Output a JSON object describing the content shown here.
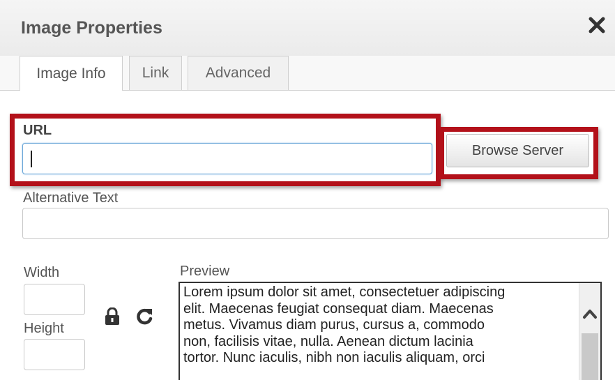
{
  "dialog": {
    "title": "Image Properties",
    "close_icon": "close-icon"
  },
  "tabs": [
    {
      "label": "Image Info",
      "active": true
    },
    {
      "label": "Link",
      "active": false
    },
    {
      "label": "Advanced",
      "active": false
    }
  ],
  "url": {
    "label": "URL",
    "value": ""
  },
  "browse_button": {
    "label": "Browse Server"
  },
  "alt_text": {
    "label": "Alternative Text",
    "value": ""
  },
  "width": {
    "label": "Width",
    "value": ""
  },
  "height": {
    "label": "Height",
    "value": ""
  },
  "icons": {
    "lock": "lock-icon",
    "reset": "reset-size-icon",
    "scroll_up": "chevron-up-icon"
  },
  "preview": {
    "label": "Preview",
    "lines": [
      "Lorem ipsum dolor sit amet, consectetuer adipiscing",
      "elit. Maecenas feugiat consequat diam. Maecenas",
      "metus. Vivamus diam purus, cursus a, commodo",
      "non, facilisis vitae, nulla. Aenean dictum lacinia",
      "tortor. Nunc iaculis, nibh non iaculis aliquam, orci"
    ]
  },
  "colors": {
    "highlight": "#b3111a",
    "focus_border": "#6aa6d8"
  }
}
